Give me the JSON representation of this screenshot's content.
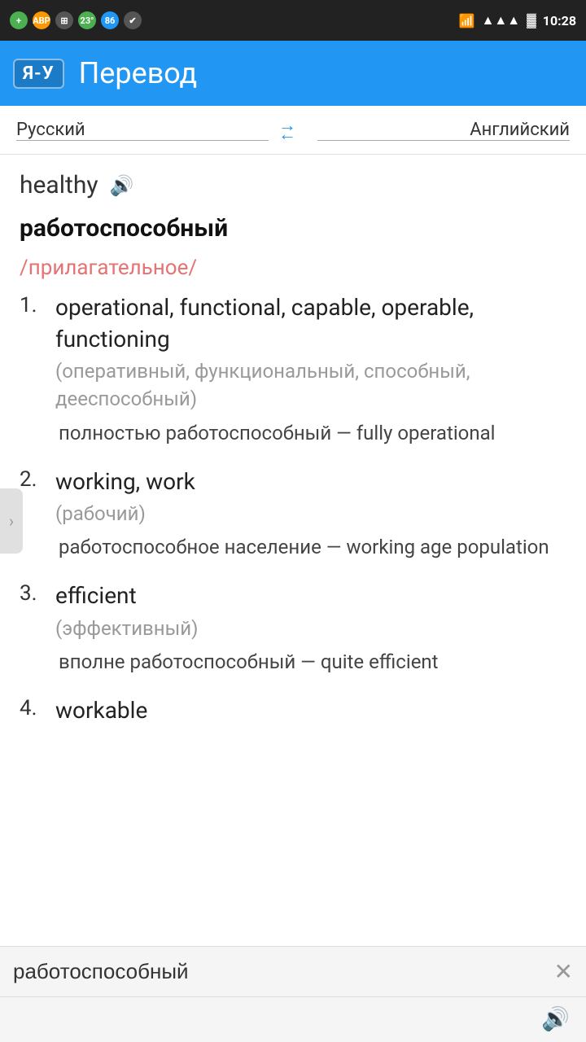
{
  "statusBar": {
    "time": "10:28",
    "icons": {
      "greenCircle": "●",
      "adBlock": "ABP",
      "grid": "⊞",
      "temp": "23°",
      "battery86": "86",
      "check": "✔",
      "wifi": "WiFi",
      "signal": "▲▲▲▲",
      "batteryIcon": "🔋"
    }
  },
  "header": {
    "logo": "Я-У",
    "title": "Перевод"
  },
  "langBar": {
    "source": "Русский",
    "target": "Английский"
  },
  "entry": {
    "searchWord": "healthy",
    "translationWord": "работоспособный",
    "partOfSpeech": "/прилагательное/",
    "definitions": [
      {
        "number": "1.",
        "main": "operational, functional, capable, operable, functioning",
        "sub": "(оперативный, функциональный, способный, дееспособный)",
        "example": "полностью работоспособный — fully operational"
      },
      {
        "number": "2.",
        "main": "working, work",
        "sub": "(рабочий)",
        "example": "работоспособное население — working age population"
      },
      {
        "number": "3.",
        "main": "efficient",
        "sub": "(эффективный)",
        "example": "вполне работоспособный — quite efficient"
      },
      {
        "number": "4.",
        "main": "workable",
        "sub": "",
        "example": ""
      }
    ]
  },
  "bottomBar": {
    "inputValue": "работоспособный",
    "inputPlaceholder": "",
    "clearLabel": "✕",
    "ttsLabel": "🔊"
  },
  "sideHandle": {
    "icon": "›"
  }
}
